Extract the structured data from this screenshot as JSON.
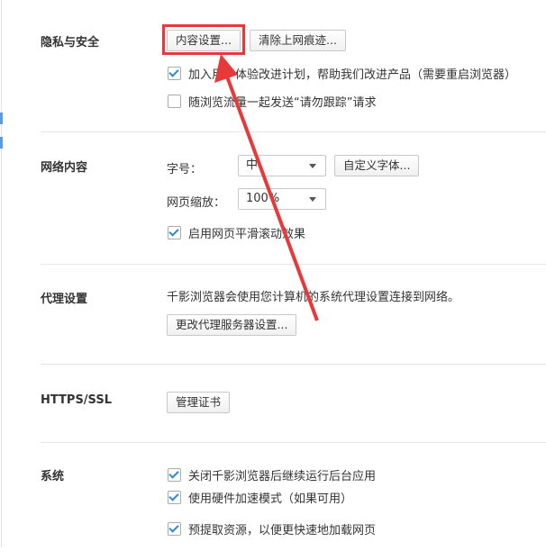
{
  "privacy": {
    "title": "隐私与安全",
    "content_settings": "内容设置...",
    "clear_history": "清除上网痕迹...",
    "options": [
      {
        "label": "加入用户体验改进计划，帮助我们改进产品（需要重启浏览器）",
        "checked": true
      },
      {
        "label": "随浏览流量一起发送“请勿跟踪”请求",
        "checked": false
      }
    ]
  },
  "web": {
    "title": "网络内容",
    "font_size_label": "字号：",
    "font_size_value": "中",
    "custom_fonts": "自定义字体...",
    "zoom_label": "网页缩放：",
    "zoom_value": "100%",
    "smooth_scroll": {
      "label": "启用网页平滑滚动效果",
      "checked": true
    }
  },
  "proxy": {
    "title": "代理设置",
    "desc": "千影浏览器会使用您计算机的系统代理设置连接到网络。",
    "change": "更改代理服务器设置..."
  },
  "https": {
    "title": "HTTPS/SSL",
    "certs": "管理证书"
  },
  "system": {
    "title": "系统",
    "options": [
      {
        "label": "关闭千影浏览器后继续运行后台应用",
        "checked": true
      },
      {
        "label": "使用硬件加速模式（如果可用）",
        "checked": true
      },
      {
        "label": "预提取资源，以便更快速地加载网页",
        "checked": true
      }
    ]
  },
  "colors": {
    "highlight": "#e8393a",
    "accent": "#2a8ad8"
  }
}
